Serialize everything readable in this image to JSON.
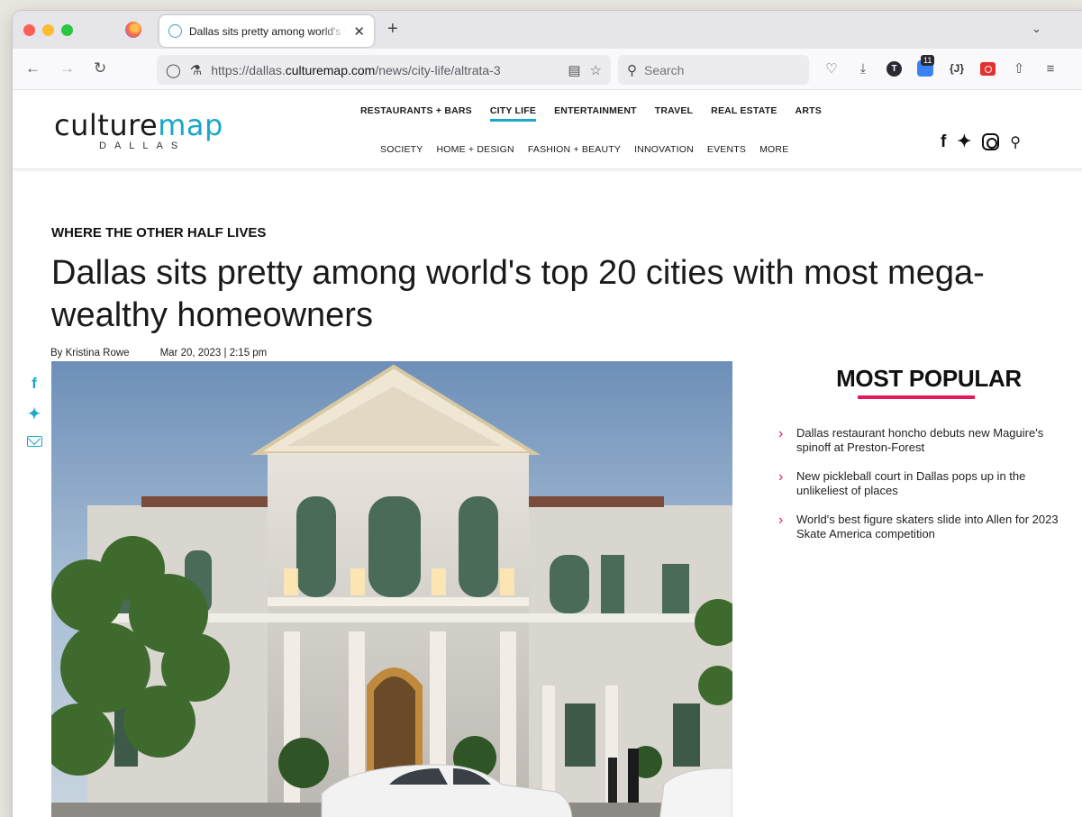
{
  "browser": {
    "tab_title": "Dallas sits pretty among world's top 20 cities with most mega-wealthy homeowners",
    "tab_close": "✕",
    "new_tab": "+",
    "url_prefix": "https://dallas.",
    "url_domain": "culturemap.com",
    "url_path": "/news/city-life/altrata-3",
    "search_placeholder": "Search",
    "extension_badge": "11",
    "json_ext_label": "{J}"
  },
  "site": {
    "logo_main_a": "culture",
    "logo_main_b": "map",
    "logo_sub": "DALLAS",
    "primary_nav": [
      "RESTAURANTS + BARS",
      "CITY LIFE",
      "ENTERTAINMENT",
      "TRAVEL",
      "REAL ESTATE",
      "ARTS"
    ],
    "secondary_nav": [
      "SOCIETY",
      "HOME + DESIGN",
      "FASHION + BEAUTY",
      "INNOVATION",
      "EVENTS",
      "MORE"
    ],
    "active_nav": "CITY LIFE"
  },
  "article": {
    "kicker": "WHERE THE OTHER HALF LIVES",
    "headline": "Dallas sits pretty among world's top 20 cities with most mega-wealthy homeowners",
    "author": "By Kristina Rowe",
    "date": "Mar 20, 2023 | 2:15 pm"
  },
  "sidebar": {
    "title": "MOST POPULAR",
    "items": [
      "Dallas restaurant honcho debuts new Maguire's spinoff at Preston-Forest",
      "New pickleball court in Dallas pops up in the unlikeliest of places",
      "World's best figure skaters slide into Allen for 2023 Skate America competition"
    ]
  },
  "colors": {
    "accent": "#1aa6c9",
    "popular_accent": "#e6195a"
  }
}
